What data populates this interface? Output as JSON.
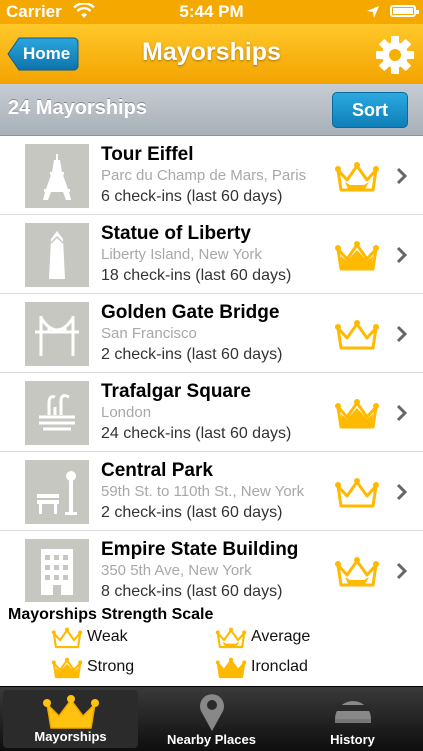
{
  "status_bar": {
    "carrier": "Carrier",
    "time": "5:44 PM"
  },
  "nav": {
    "back_label": "Home",
    "title": "Mayorships"
  },
  "header": {
    "count_label": "24 Mayorships",
    "sort_label": "Sort"
  },
  "colors": {
    "accent": "#f5a800",
    "crown": "#ffbe00",
    "sort": "#1a95d0"
  },
  "mayorships": [
    {
      "name": "Tour Eiffel",
      "address": "Parc du Champ de Mars, Paris",
      "checkins": "6 check-ins (last 60 days)",
      "strength": "Average",
      "icon": "eiffel-tower-icon"
    },
    {
      "name": "Statue of Liberty",
      "address": "Liberty Island, New York",
      "checkins": "18 check-ins (last 60 days)",
      "strength": "Strong",
      "icon": "obelisk-icon"
    },
    {
      "name": "Golden Gate Bridge",
      "address": "San Francisco",
      "checkins": "2 check-ins (last 60 days)",
      "strength": "Weak",
      "icon": "bridge-icon"
    },
    {
      "name": "Trafalgar Square",
      "address": "London",
      "checkins": "24 check-ins (last 60 days)",
      "strength": "Strong",
      "icon": "fountain-icon"
    },
    {
      "name": "Central Park",
      "address": "59th St. to 110th St., New York",
      "checkins": "2 check-ins (last 60 days)",
      "strength": "Weak",
      "icon": "park-bench-icon"
    },
    {
      "name": "Empire State Building",
      "address": "350 5th Ave, New York",
      "checkins": "8 check-ins (last 60 days)",
      "strength": "Average",
      "icon": "building-icon"
    }
  ],
  "scale": {
    "title": "Mayorships Strength Scale",
    "levels": [
      "Weak",
      "Average",
      "Strong",
      "Ironclad"
    ]
  },
  "tabs": [
    {
      "label": "Mayorships",
      "icon": "crown-icon",
      "active": true
    },
    {
      "label": "Nearby Places",
      "icon": "map-pin-icon",
      "active": false
    },
    {
      "label": "History",
      "icon": "helmet-icon",
      "active": false
    }
  ]
}
